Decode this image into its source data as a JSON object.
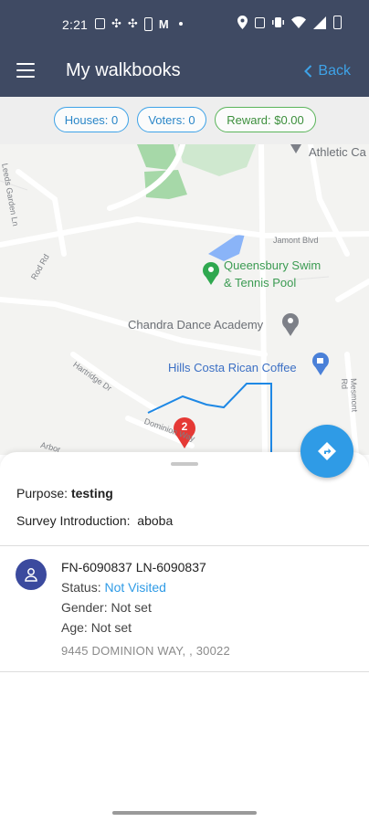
{
  "status_bar": {
    "time": "2:21"
  },
  "app_bar": {
    "title": "My walkbooks",
    "back_label": "Back"
  },
  "stats": {
    "houses": "Houses: 0",
    "voters": "Voters: 0",
    "reward": "Reward: $0.00"
  },
  "map": {
    "labels": {
      "athletic": "Athletic Ca",
      "swim_line1": "Queensbury Swim",
      "swim_line2": "& Tennis Pool",
      "dance": "Chandra Dance Academy",
      "coffee": "Hills Costa Rican Coffee",
      "road_jamont": "Jamont Blvd",
      "road_garden": "Leeds Garden Ln",
      "road_rod": "Rod Rd",
      "road_hartridge": "Hartridge Dr",
      "road_dominion": "Dominion Way",
      "road_arbor": "Arbor",
      "road_mesmont": "Mesmont Rd"
    },
    "marker_count": "2"
  },
  "sheet": {
    "purpose_label": "Purpose:",
    "purpose_value": "testing",
    "intro_label": "Survey Introduction:",
    "intro_value": "aboba"
  },
  "voter": {
    "name": "FN-6090837 LN-6090837",
    "status_label": "Status:",
    "status_value": "Not Visited",
    "gender": "Gender: Not set",
    "age": "Age: Not set",
    "address": "9445 DOMINION WAY, , 30022"
  },
  "colors": {
    "app_bar": "#3f4a63",
    "accent_blue": "#2f9be6",
    "reward_green": "#5bb55b",
    "marker_red": "#e53935"
  }
}
